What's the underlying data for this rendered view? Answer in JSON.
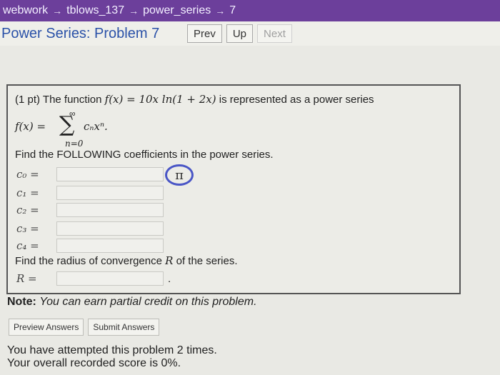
{
  "breadcrumb": {
    "items": [
      "webwork",
      "tblows_137",
      "power_series",
      "7"
    ],
    "separator": "→"
  },
  "header": {
    "title": "Power Series: Problem 7",
    "nav": {
      "prev": "Prev",
      "up": "Up",
      "next": "Next"
    }
  },
  "problem": {
    "intro": "(1 pt) The function",
    "function_expr": "f(x) = 10x ln(1 + 2x)",
    "intro_tail": "is represented as a power series",
    "series_lhs": "f(x) =",
    "series_sum": "∑",
    "series_upper": "∞",
    "series_lower": "n=0",
    "series_term": "cₙxⁿ.",
    "coef_prompt": "Find the FOLLOWING coefficients in the power series.",
    "coefficients": [
      {
        "label": "c₀ =",
        "value": ""
      },
      {
        "label": "c₁ =",
        "value": ""
      },
      {
        "label": "c₂ =",
        "value": ""
      },
      {
        "label": "c₃ =",
        "value": ""
      },
      {
        "label": "c₄ =",
        "value": ""
      }
    ],
    "pi_badge": "π",
    "radius_prompt_a": "Find the radius of convergence",
    "radius_symbol": "R",
    "radius_prompt_b": "of the series.",
    "radius_label": "R =",
    "radius_value": "",
    "radius_tail": "."
  },
  "note": {
    "bold": "Note:",
    "text": "You can earn partial credit on this problem."
  },
  "actions": {
    "preview": "Preview Answers",
    "submit": "Submit Answers"
  },
  "status": {
    "attempts": "You have attempted this problem 2 times.",
    "score": "Your overall recorded score is 0%."
  },
  "colors": {
    "topbar": "#6c3f9b",
    "title": "#2b52a8",
    "pi_ring": "#4a56c6"
  }
}
